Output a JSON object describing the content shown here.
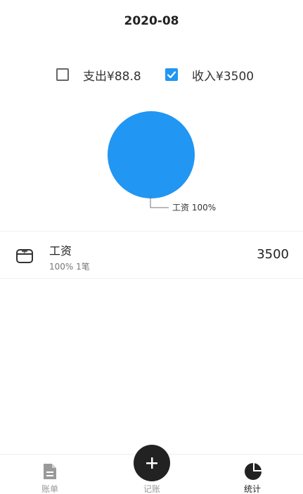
{
  "header": {
    "title": "2020-08"
  },
  "filters": {
    "expense": {
      "label": "支出¥88.8",
      "checked": false
    },
    "income": {
      "label": "收入¥3500",
      "checked": true
    }
  },
  "chart_data": {
    "type": "pie",
    "slices": [
      {
        "label": "工资",
        "value": 100,
        "display": "工资 100%",
        "color": "#2196f3"
      }
    ]
  },
  "category_list": [
    {
      "icon": "wallet-icon",
      "name": "工资",
      "meta": "100% 1笔",
      "amount": "3500"
    }
  ],
  "tabbar": {
    "bills": {
      "label": "账单",
      "icon": "document-icon"
    },
    "record": {
      "label": "记账",
      "icon": "plus-icon"
    },
    "stats": {
      "label": "统计",
      "icon": "pie-chart-icon"
    }
  },
  "colors": {
    "accent": "#2196f3",
    "dark": "#222222",
    "muted": "#999999"
  }
}
